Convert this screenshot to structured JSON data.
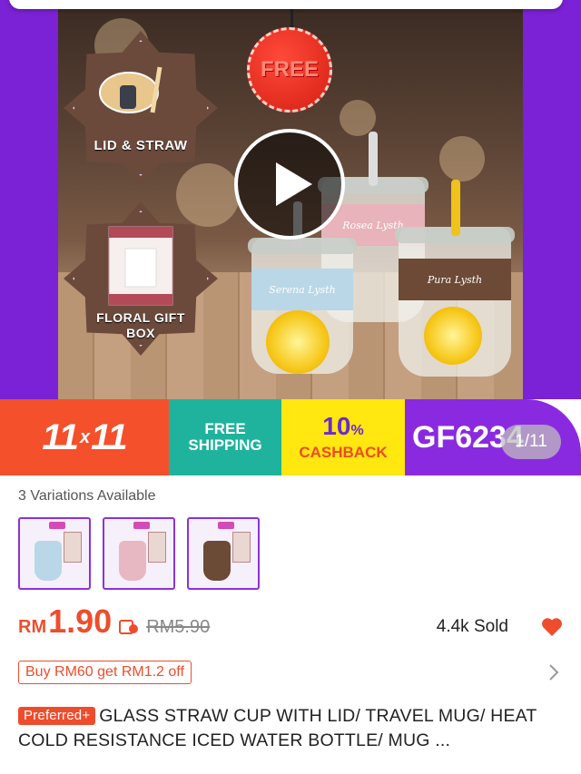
{
  "hero": {
    "badge_lid_label": "LID & STRAW",
    "badge_gift_label": "FLORAL GIFT BOX",
    "free_tag_text": "FREE",
    "play_icon": "play-icon",
    "image_counter": "1/11"
  },
  "promo": {
    "date_label": "11",
    "date_label_b": "11",
    "date_sep": "x",
    "free_shipping_line1": "FREE",
    "free_shipping_line2": "SHIPPING",
    "cashback_value": "10",
    "cashback_pct": "%",
    "cashback_label": "CASHBACK",
    "voucher_code": "GF6234"
  },
  "product": {
    "variations_label": "3 Variations Available",
    "variations": [
      {
        "color": "#b9d7e6"
      },
      {
        "color": "#e8b8c2"
      },
      {
        "color": "#6b4a36"
      }
    ],
    "currency": "RM",
    "price": "1.90",
    "original_price": "RM5.90",
    "sold": "4.4k Sold",
    "voucher_text": "Buy RM60 get RM1.2 off",
    "preferred_badge": "Preferred+",
    "title": "GLASS STRAW CUP WITH LID/ TRAVEL MUG/ HEAT COLD RESISTANCE ICED WATER BOTTLE/ MUG ..."
  },
  "colors": {
    "accent": "#ee4d2d",
    "purple": "#8a2ae0"
  }
}
